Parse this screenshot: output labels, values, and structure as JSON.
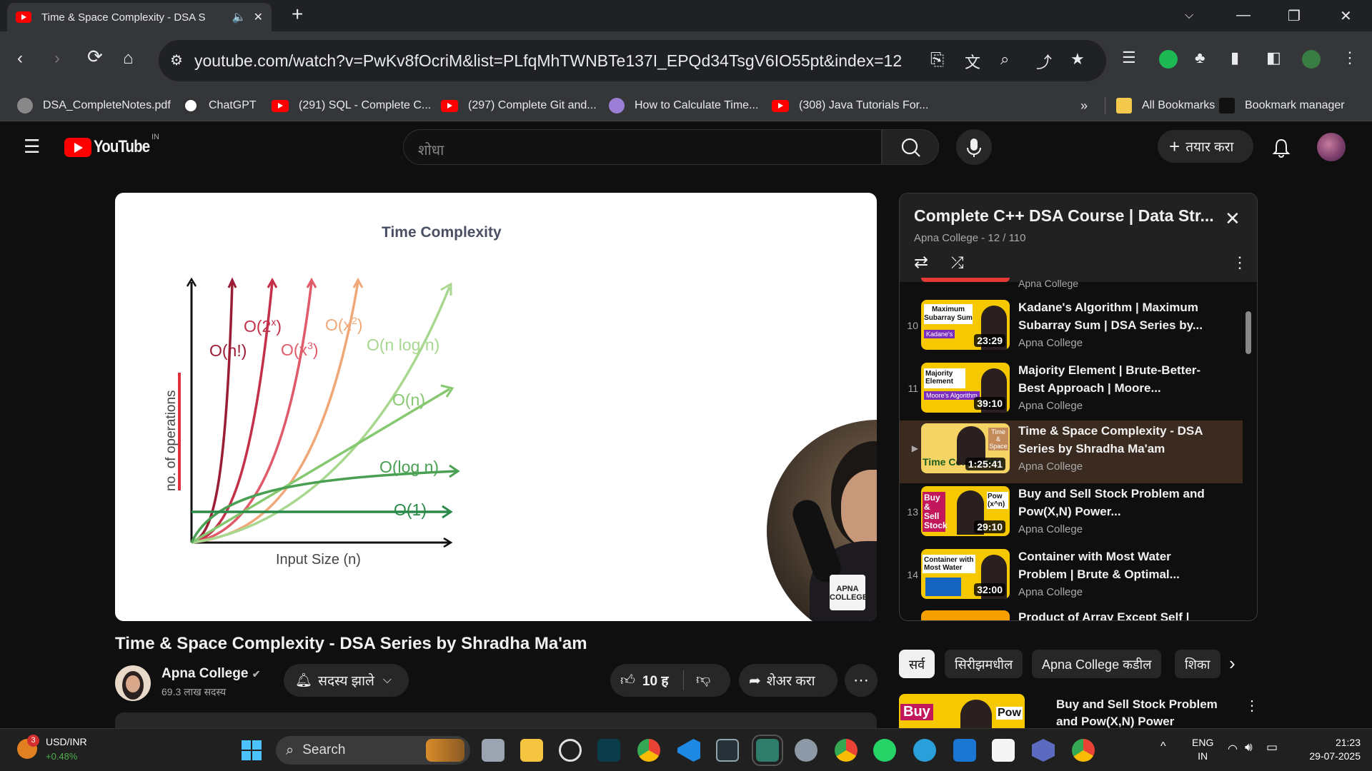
{
  "browser": {
    "tab": {
      "title": "Time & Space Complexity - DSA S"
    },
    "url": "youtube.com/watch?v=PwKv8fOcriM&list=PLfqMhTWNBTe137I_EPQd34TsgV6IO55pt&index=12",
    "bookmarks": [
      {
        "label": "DSA_CompleteNotes.pdf"
      },
      {
        "label": "ChatGPT"
      },
      {
        "label": "(291) SQL - Complete C..."
      },
      {
        "label": "(297) Complete Git and..."
      },
      {
        "label": "How to Calculate Time..."
      },
      {
        "label": "(308) Java Tutorials For..."
      }
    ],
    "bookmarks_more": "»",
    "all_bookmarks": "All Bookmarks",
    "bookmark_manager": "Bookmark manager"
  },
  "youtube": {
    "logo_text": "YouTube",
    "region": "IN",
    "search_placeholder": "शोधा",
    "create_label": "तयार करा"
  },
  "video": {
    "slide": {
      "title": "Time Complexity",
      "xlabel": "Input Size (n)",
      "ylabel": "no. of operations",
      "curves": [
        "O(n!)",
        "O(2",
        "x",
        ")",
        "O(x",
        "3",
        ")",
        "O(x",
        "2",
        ")",
        "O(n log n)",
        "O(n)",
        "O(log n)",
        "O(1)"
      ]
    },
    "watermark": "APNA COLLEGE",
    "title": "Time & Space Complexity - DSA Series by Shradha Ma'am",
    "channel": "Apna College",
    "subscribers": "69.3 लाख सदस्य",
    "subscribed_label": "सदस्य झाले",
    "likes": "10 ह",
    "share_label": "शेअर करा"
  },
  "playlist": {
    "title": "Complete C++ DSA Course | Data Str...",
    "subtitle": "Apna College - 12 / 110",
    "top_partial_channel": "Apna College",
    "items": [
      {
        "index": "10",
        "title": "Kadane's Algorithm | Maximum Subarray Sum | DSA Series by...",
        "channel": "Apna College",
        "duration": "23:29",
        "thumb_text": "Maximum Subarray Sum",
        "thumb_tag": "Kadane's"
      },
      {
        "index": "11",
        "title": "Majority Element | Brute-Better-Best Approach | Moore...",
        "channel": "Apna College",
        "duration": "39:10",
        "thumb_text": "Majority Element",
        "thumb_tag": "Moore's Algorithm"
      },
      {
        "index": "▶",
        "title": "Time & Space Complexity - DSA Series by Shradha Ma'am",
        "channel": "Apna College",
        "duration": "1:25:41",
        "thumb_text": "Time Complexity",
        "thumb_tag": "Time & Space"
      },
      {
        "index": "13",
        "title": "Buy and Sell Stock Problem and Pow(X,N) Power...",
        "channel": "Apna College",
        "duration": "29:10",
        "thumb_text": "Buy & Sell Stock",
        "thumb_tag": "Pow (x^n)"
      },
      {
        "index": "14",
        "title": "Container with Most Water Problem | Brute & Optimal...",
        "channel": "Apna College",
        "duration": "32:00",
        "thumb_text": "Container with Most Water",
        "thumb_tag": ""
      }
    ],
    "bottom_partial": "Product of Array Except Self |"
  },
  "chips": [
    "सर्व",
    "सिरीझमधील",
    "Apna College कडील",
    "शिका"
  ],
  "recommended": {
    "title": "Buy and Sell Stock Problem and Pow(X,N) Power exponential ...",
    "thumb_left": "Buy",
    "thumb_right": "Pow"
  },
  "taskbar": {
    "ticker": "USD/INR",
    "change": "+0.48%",
    "badge": "3",
    "search_label": "Search",
    "lang1": "ENG",
    "lang2": "IN",
    "time": "21:23",
    "date": "29-07-2025"
  },
  "colors": {
    "accent_red": "#ff0000",
    "now_playing_bg": "#3a2a20"
  }
}
